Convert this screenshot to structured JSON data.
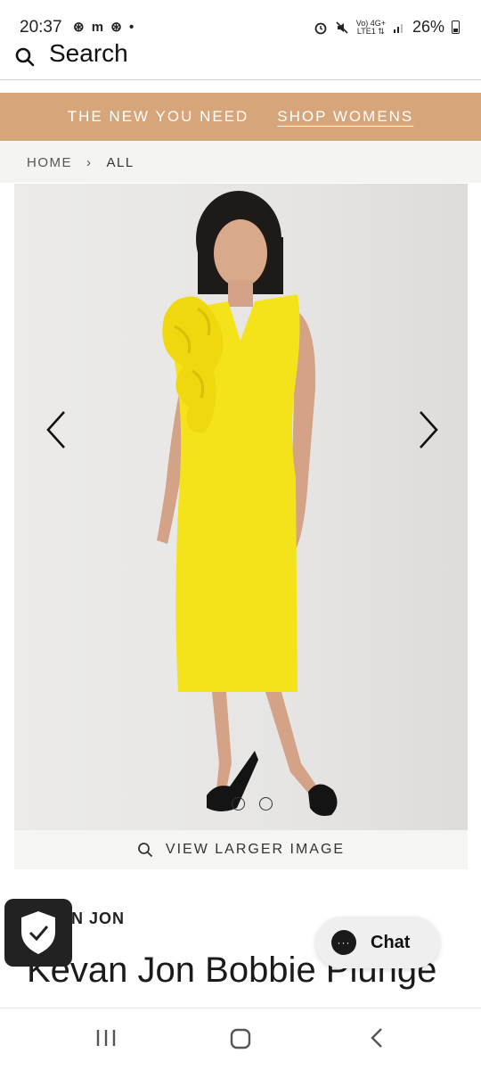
{
  "status_bar": {
    "time": "20:37",
    "left_icons": "⊛ m ⊛ •",
    "network_top": "Vo) 4G+",
    "network_bottom": "LTE1 ⇅",
    "battery_percent": "26%"
  },
  "search": {
    "label": "Search"
  },
  "promo": {
    "text": "THE NEW YOU NEED",
    "link": "SHOP WOMENS",
    "bg_color": "#d7a57a"
  },
  "breadcrumb": {
    "home": "HOME",
    "separator": "›",
    "current": "ALL"
  },
  "gallery": {
    "dots": [
      {
        "active": true
      },
      {
        "active": false
      }
    ],
    "view_larger_label": "VIEW LARGER IMAGE"
  },
  "product": {
    "brand_partial": "N JON",
    "title_partial": "Kevan Jon Bobbie Plunge"
  },
  "chat": {
    "label": "Chat",
    "icon_glyph": "···"
  },
  "icons": {
    "search": "search-icon",
    "prev": "chevron-left-icon",
    "next": "chevron-right-icon",
    "shield": "shield-check-icon",
    "chat": "chat-bubble-icon",
    "recents": "recents-icon",
    "home": "home-icon",
    "back": "back-icon"
  }
}
